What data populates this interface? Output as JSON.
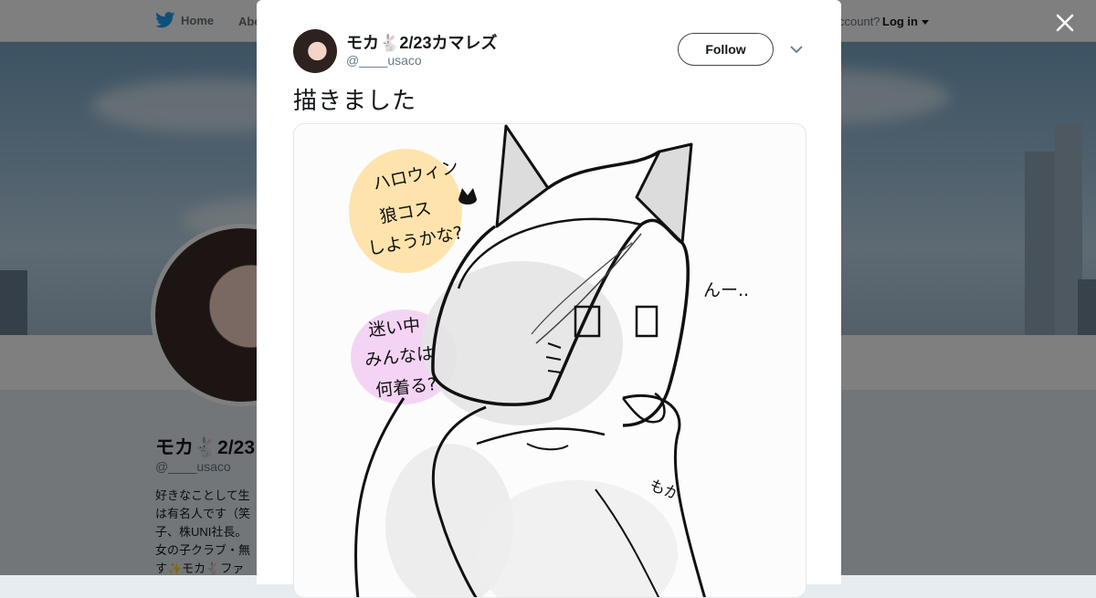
{
  "topbar": {
    "home_label": "Home",
    "about_label": "Abo",
    "account_text": "ccount?",
    "login_label": "Log in"
  },
  "profile": {
    "name_prefix": "モカ",
    "name_suffix": "2/23",
    "handle": "@____usaco",
    "bio_lines": [
      "好きなことして生",
      "は有名人です（笑",
      "子、株UNI社長。",
      "女の子クラブ・無",
      "す✨モカ🐇ファ"
    ]
  },
  "tweet": {
    "author_prefix": "モカ",
    "author_suffix": "2/23カマレズ",
    "handle": "@____usaco",
    "follow_label": "Follow",
    "text": "描きました"
  },
  "drawing": {
    "note_halloween": [
      "ハロウィン",
      "狼コス",
      "しようかな?"
    ],
    "note_mayoi": [
      "迷い中",
      "みんなは",
      "何着る?"
    ],
    "note_hmm": "んー..",
    "signature": "もか"
  },
  "colors": {
    "twitter_blue": "#1da1f2",
    "overlay": "rgba(0,0,0,0.5)",
    "highlight_orange": "#ffd98a",
    "highlight_pink": "#f1c7f2"
  },
  "icons": {
    "home": "twitter-bird-icon",
    "close": "close-icon",
    "caret": "chevron-down-icon",
    "rabbit": "rabbit-icon"
  }
}
